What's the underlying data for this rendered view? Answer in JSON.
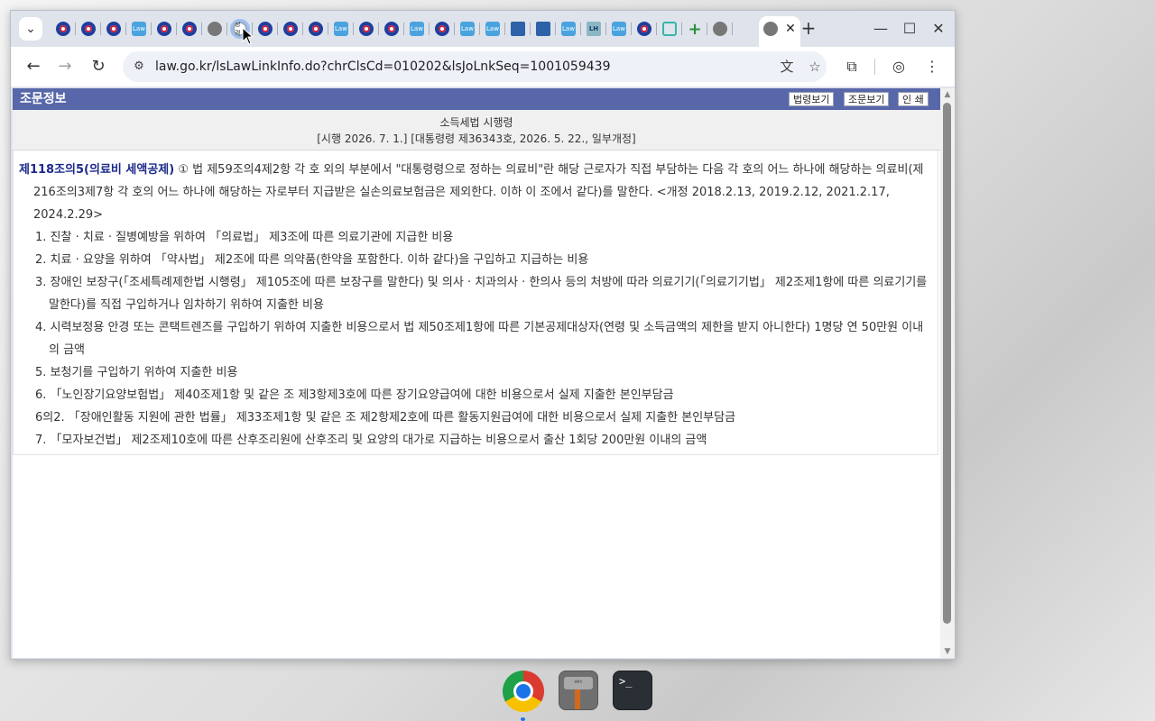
{
  "browser": {
    "tab_search_icon": "chevron-down-icon",
    "tabs": [
      {
        "icon": "o"
      },
      {
        "icon": "o"
      },
      {
        "icon": "o"
      },
      {
        "icon": "k",
        "badge": "Law"
      },
      {
        "icon": "o"
      },
      {
        "icon": "o"
      },
      {
        "icon": "g"
      },
      {
        "icon": "s",
        "badge": "정경",
        "highlight": true
      },
      {
        "icon": "o"
      },
      {
        "icon": "o"
      },
      {
        "icon": "o"
      },
      {
        "icon": "k",
        "badge": "Law"
      },
      {
        "icon": "o"
      },
      {
        "icon": "o"
      },
      {
        "icon": "k",
        "badge": "Law"
      },
      {
        "icon": "o"
      },
      {
        "icon": "k",
        "badge": "Law"
      },
      {
        "icon": "k",
        "badge": "Law"
      },
      {
        "icon": "b"
      },
      {
        "icon": "b"
      },
      {
        "icon": "k",
        "badge": "Law"
      },
      {
        "icon": "l",
        "badge": "LH"
      },
      {
        "icon": "k",
        "badge": "Law"
      },
      {
        "icon": "o"
      },
      {
        "icon": "h"
      },
      {
        "icon": "p",
        "badge": "+"
      },
      {
        "icon": "g"
      }
    ],
    "active_tab_close": "✕",
    "new_tab": "+",
    "window_controls": {
      "minimize": "—",
      "maximize": "☐",
      "close": "✕"
    },
    "url": "law.go.kr/lsLawLinkInfo.do?chrClsCd=010202&lsJoLnkSeq=1001059439"
  },
  "page": {
    "panel_title": "조문정보",
    "buttons": {
      "law_view": "법령보기",
      "article_view": "조문보기",
      "print": "인 쇄"
    },
    "law_name": "소득세법 시행령",
    "law_meta": "[시행 2026. 7. 1.] [대통령령 제36343호, 2026. 5. 22., 일부개정]",
    "article": {
      "heading": "제118조의5(의료비 세액공제)",
      "text": " ① 법 제59조의4제2항 각 호 외의 부분에서 \"대통령령으로 정하는 의료비\"란 해당 근로자가 직접 부담하는 다음 각 호의 어느 하나에 해당하는 의료비(제216조의3제7항 각 호의 어느 하나에 해당하는 자로부터 지급받은 실손의료보험금은 제외한다. 이하 이 조에서 같다)를 말한다. <개정 2018.2.13, 2019.2.12, 2021.2.17, 2024.2.29>",
      "items": [
        "1. 진찰 · 치료 · 질병예방을 위하여 「의료법」 제3조에 따른 의료기관에 지급한 비용",
        "2. 치료 · 요양을 위하여 「약사법」 제2조에 따른 의약품(한약을 포함한다. 이하 같다)을 구입하고 지급하는 비용",
        "3. 장애인 보장구(「조세특례제한법 시행령」 제105조에 따른 보장구를 말한다) 및 의사 · 치과의사 · 한의사 등의 처방에 따라 의료기기(「의료기기법」 제2조제1항에 따른 의료기기를 말한다)를 직접 구입하거나 임차하기 위하여 지출한 비용",
        "4. 시력보정용 안경 또는 콘택트렌즈를 구입하기 위하여 지출한 비용으로서 법 제50조제1항에 따른 기본공제대상자(연령 및 소득금액의 제한을 받지 아니한다) 1명당 연 50만원 이내의 금액",
        "5. 보청기를 구입하기 위하여 지출한 비용",
        "6. 「노인장기요양보험법」 제40조제1항 및 같은 조 제3항제3호에 따른 장기요양급여에 대한 비용으로서 실제 지출한 본인부담금",
        "6의2. 「장애인활동 지원에 관한 법률」 제33조제1항 및 같은 조 제2항제2호에 따른 활동지원급여에 대한 비용으로서 실제 지출한 본인부담금",
        "7. 「모자보건법」 제2조제10호에 따른 산후조리원에 산후조리 및 요양의 대가로 지급하는 비용으로서 출산 1회당 200만원 이내의 금액"
      ]
    }
  },
  "dock": {
    "items": [
      "chrome-icon",
      "tool-app-icon",
      "terminal-icon"
    ],
    "terminal_prompt": ">_",
    "tool_label": "ᵃᵇᶜ"
  }
}
